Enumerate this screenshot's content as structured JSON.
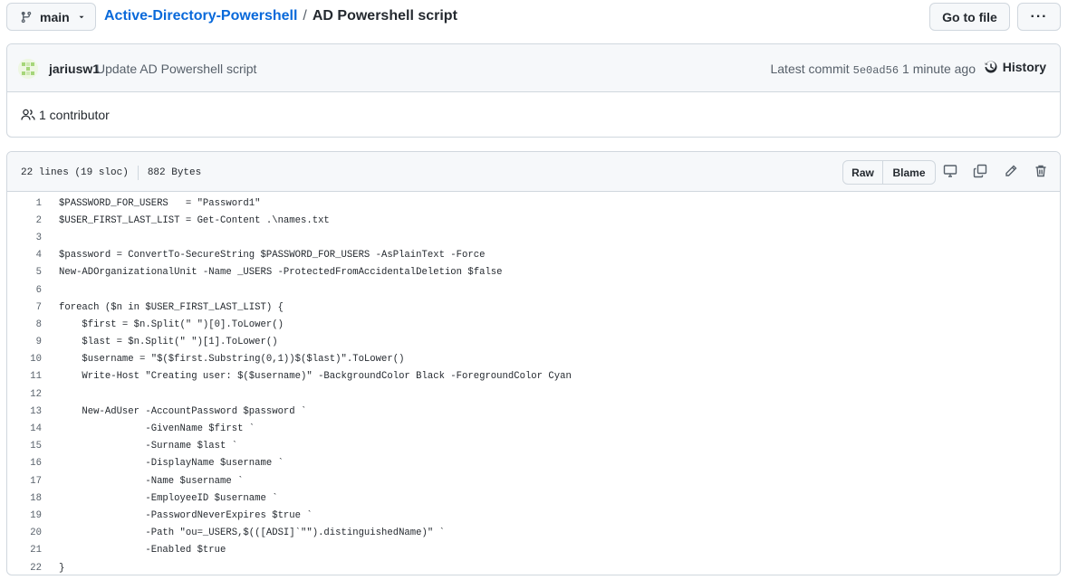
{
  "nav": {
    "branch": "main",
    "repo_name": "Active-Directory-Powershell",
    "separator": "/",
    "file_name": "AD Powershell script",
    "goto_label": "Go to file",
    "more_label": "···"
  },
  "commit": {
    "author": "jariusw1",
    "message": "Update AD Powershell script",
    "latest_label": "Latest commit",
    "sha": "5e0ad56",
    "time_ago": "1 minute ago",
    "history_label": "History"
  },
  "contributors": {
    "text": "1 contributor"
  },
  "file": {
    "lines_info": "22 lines (19 sloc)",
    "size": "882 Bytes",
    "raw_label": "Raw",
    "blame_label": "Blame"
  },
  "code_lines": [
    "$PASSWORD_FOR_USERS   = \"Password1\"",
    "$USER_FIRST_LAST_LIST = Get-Content .\\names.txt",
    "",
    "$password = ConvertTo-SecureString $PASSWORD_FOR_USERS -AsPlainText -Force",
    "New-ADOrganizationalUnit -Name _USERS -ProtectedFromAccidentalDeletion $false",
    "",
    "foreach ($n in $USER_FIRST_LAST_LIST) {",
    "    $first = $n.Split(\" \")[0].ToLower()",
    "    $last = $n.Split(\" \")[1].ToLower()",
    "    $username = \"$($first.Substring(0,1))$($last)\".ToLower()",
    "    Write-Host \"Creating user: $($username)\" -BackgroundColor Black -ForegroundColor Cyan",
    "",
    "    New-AdUser -AccountPassword $password `",
    "               -GivenName $first `",
    "               -Surname $last `",
    "               -DisplayName $username `",
    "               -Name $username `",
    "               -EmployeeID $username `",
    "               -PasswordNeverExpires $true `",
    "               -Path \"ou=_USERS,$(([ADSI]`\"\").distinguishedName)\" `",
    "               -Enabled $true",
    "}"
  ],
  "colors": {
    "link": "#0969da",
    "border": "#d0d7de",
    "header_bg": "#f6f8fa",
    "muted": "#57606a"
  }
}
